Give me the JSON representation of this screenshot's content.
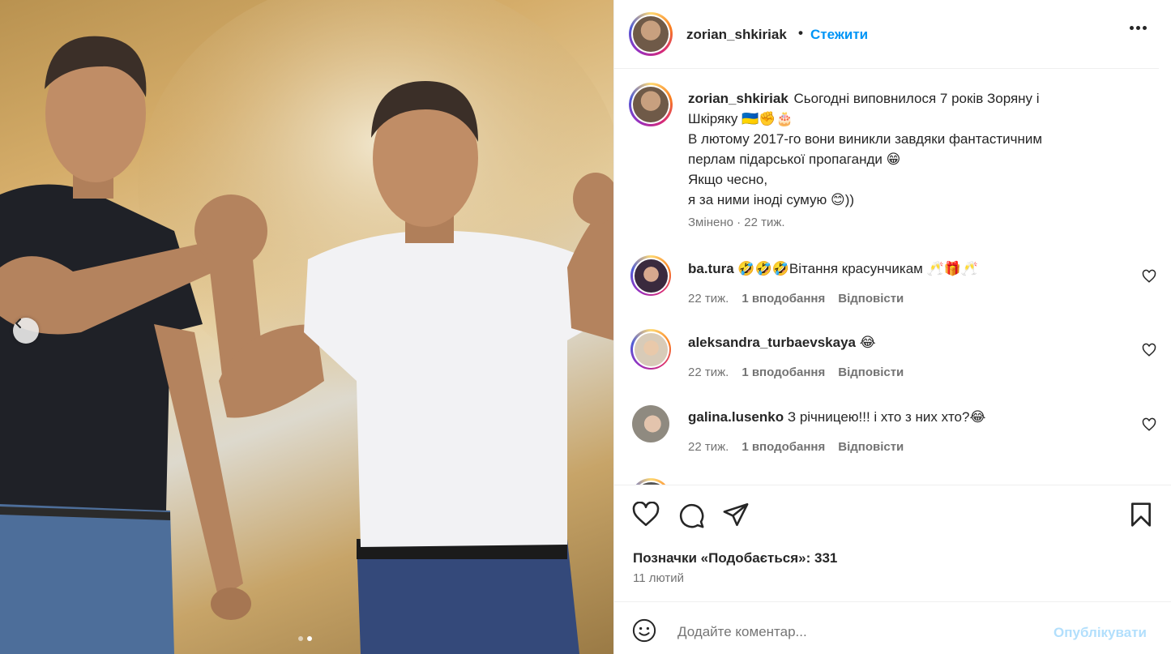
{
  "post": {
    "author": "zorian_shkiriak",
    "separator": "•",
    "follow_label": "Стежити",
    "caption": {
      "line1": "Сьогодні виповнилося 7 років Зоряну і",
      "line2": "Шкіряку 🇺🇦✊🎂",
      "line3": "В лютому 2017-го вони виникли завдяки фантастичним",
      "line4": "перлам підарської пропаганди 😁",
      "line5": "Якщо чесно,",
      "line6": "я за ними іноді сумую 😊))",
      "edited": "Змінено · 22 тиж."
    },
    "likes_text": "Позначки «Подобається»: 331",
    "date": "11 лютий"
  },
  "comments": [
    {
      "user": "ba.tura",
      "text": "🤣🤣🤣Вітання красунчикам 🥂🎁🥂",
      "time": "22 тиж.",
      "likes": "1 вподобання",
      "reply": "Відповісти"
    },
    {
      "user": "aleksandra_turbaevskaya",
      "text": "😂",
      "time": "22 тиж.",
      "likes": "1 вподобання",
      "reply": "Відповісти"
    },
    {
      "user": "galina.lusenko",
      "text": "З річницею!!! і хто з них хто?😂",
      "time": "22 тиж.",
      "likes": "1 вподобання",
      "reply": "Відповісти"
    }
  ],
  "composer": {
    "placeholder": "Додайте коментар...",
    "post_label": "Опублікувати"
  },
  "carousel": {
    "slides": 2,
    "current": 2
  },
  "icons": {
    "prev": "chevron-left-icon",
    "more": "more-options-icon",
    "like": "heart-icon",
    "comment": "comment-icon",
    "share": "share-icon",
    "save": "bookmark-icon",
    "emoji": "emoji-icon"
  },
  "colors": {
    "accent": "#0095f6",
    "text": "#262626",
    "muted": "#737373",
    "post_disabled": "#b2dffc"
  }
}
